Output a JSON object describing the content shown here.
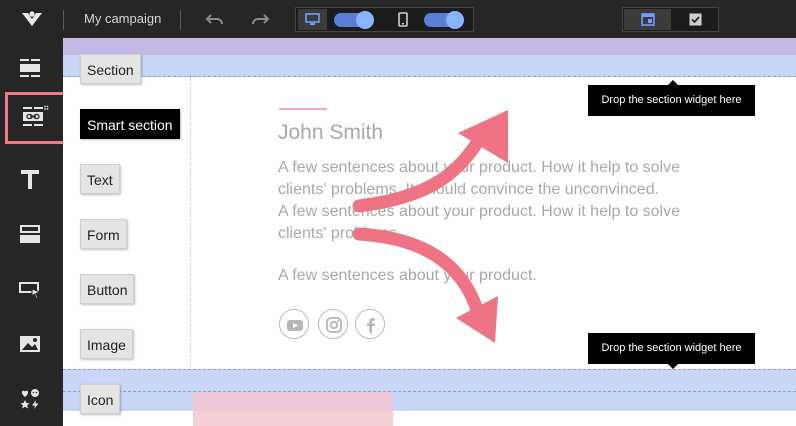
{
  "topbar": {
    "campaign_name": "My campaign",
    "icons": [
      "logo-icon",
      "undo-icon",
      "redo-icon",
      "desktop-icon",
      "mobile-icon",
      "layout-view-icon",
      "checkbox-view-icon"
    ],
    "desktop_toggle_on": true,
    "mobile_toggle_on": true
  },
  "sidebar": {
    "items": [
      {
        "icon": "section-widget-icon"
      },
      {
        "icon": "smart-section-widget-icon",
        "active": true
      },
      {
        "icon": "text-widget-icon"
      },
      {
        "icon": "form-widget-icon"
      },
      {
        "icon": "button-widget-icon"
      },
      {
        "icon": "image-widget-icon"
      },
      {
        "icon": "icon-widget-icon"
      }
    ]
  },
  "widgets": [
    {
      "label": "Section"
    },
    {
      "label": "Smart section"
    },
    {
      "label": "Text"
    },
    {
      "label": "Form"
    },
    {
      "label": "Button"
    },
    {
      "label": "Image"
    },
    {
      "label": "Icon"
    }
  ],
  "content": {
    "name": "John Smith",
    "paragraph_lines": [
      "A few sentences about your product. How it help to solve",
      "clients' problems. It should convince the unconvinced.",
      "A few sentences about your product. How it help to solve",
      "clients' problems."
    ],
    "short_paragraph": "A few sentences about your product.",
    "social_icons": [
      "youtube-icon",
      "instagram-icon",
      "facebook-icon"
    ]
  },
  "tooltips": {
    "top": "Drop the section widget here",
    "bottom": "Drop the section widget here"
  },
  "colors": {
    "accent": "#f07a8a",
    "arrow": "#ee7385",
    "drop_zone": "#c8d6f7",
    "toggle": "#5b7fd9"
  }
}
